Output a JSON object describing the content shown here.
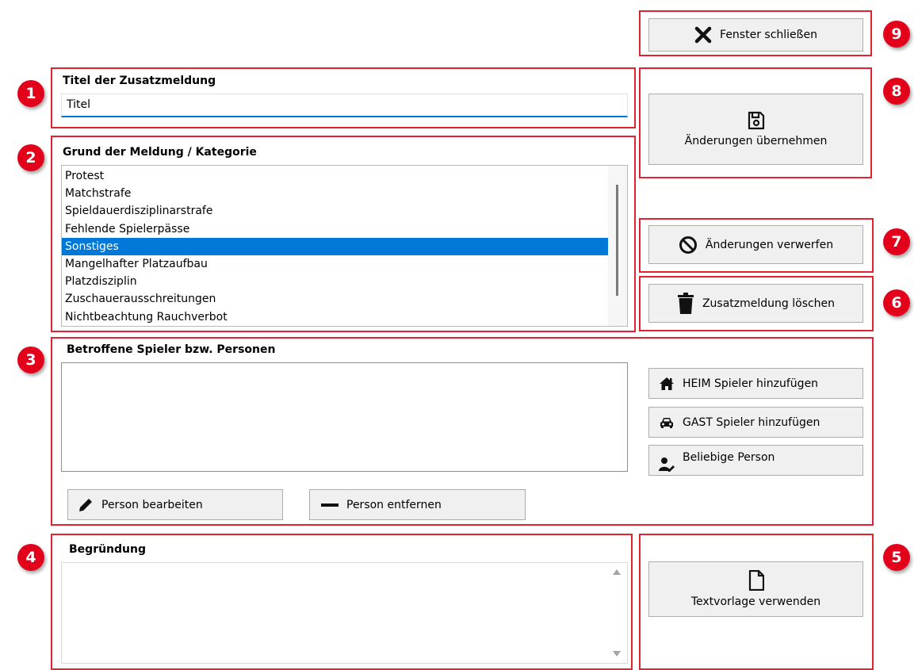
{
  "markers": [
    "1",
    "2",
    "3",
    "4",
    "5",
    "6",
    "7",
    "8",
    "9"
  ],
  "title_section": {
    "heading": "Titel der Zusatzmeldung",
    "input_value": "Titel"
  },
  "category_section": {
    "heading": "Grund der Meldung / Kategorie",
    "items": [
      "Protest",
      "Matchstrafe",
      "Spieldauerdisziplinarstrafe",
      "Fehlende Spielerpässe",
      "Sonstiges",
      "Mangelhafter Platzaufbau",
      "Platzdisziplin",
      "Zuschauerausschreitungen",
      "Nichtbeachtung Rauchverbot"
    ],
    "selected_item": "Sonstiges"
  },
  "players_section": {
    "heading": "Betroffene Spieler bzw. Personen",
    "add_home_label": "HEIM Spieler hinzufügen",
    "add_guest_label": "GAST Spieler hinzufügen",
    "any_person_label": "Beliebige Person",
    "edit_person_label": "Person bearbeiten",
    "remove_person_label": "Person entfernen"
  },
  "reason_section": {
    "heading": "Begründung",
    "text": ""
  },
  "actions": {
    "close_label": "Fenster schließen",
    "save_label": "Änderungen übernehmen",
    "discard_label": "Änderungen verwerfen",
    "delete_label": "Zusatzmeldung löschen",
    "template_label": "Textvorlage verwenden"
  },
  "icons": {
    "close": "close-icon",
    "save": "save-icon",
    "discard": "cancel-icon",
    "delete": "trash-icon",
    "home": "home-icon",
    "car": "car-icon",
    "person": "user-edit-icon",
    "edit": "pencil-icon",
    "remove": "minus-icon",
    "template": "document-icon"
  },
  "colors": {
    "annotation_red": "#e02231",
    "selection_blue": "#0078d7",
    "input_underline": "#0078d7",
    "button_bg": "#f0f0f0"
  }
}
